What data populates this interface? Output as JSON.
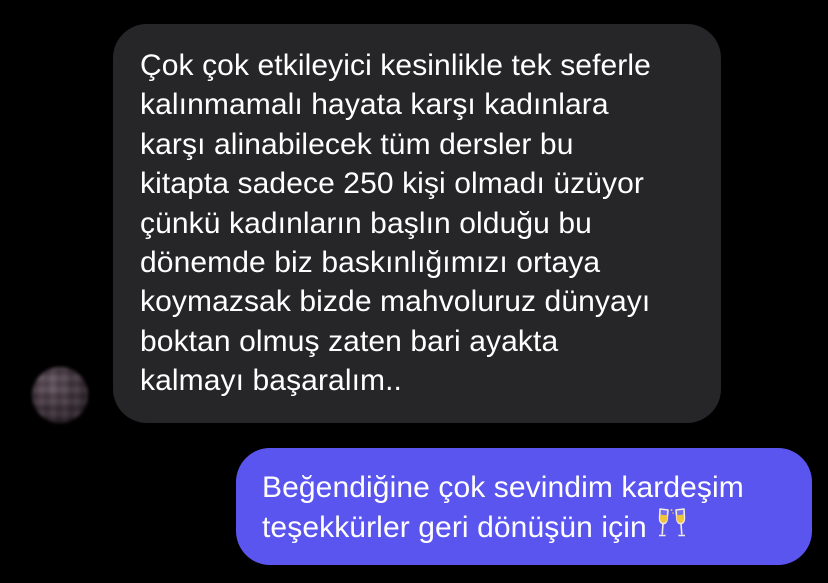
{
  "conversation": {
    "incoming": {
      "text": "Çok çok etkileyici kesinlikle tek seferle\nkalınmamalı hayata karşı kadınlara\nkarşı alinabilecek tüm dersler bu\nkitapta sadece 250 kişi olmadı üzüyor\nçünkü kadınların başlın olduğu bu\ndönemde biz baskınlığımızı ortaya\nkoymazsak bizde mahvoluruz dünyayı\nboktan olmuş zaten bari ayakta\nkalmayı başaralım.."
    },
    "outgoing": {
      "text": "Beğendiğine çok sevindim kardeşim\nteşekkürler geri dönüşün için",
      "emoji_name": "clinking-glasses"
    }
  },
  "colors": {
    "background": "#000000",
    "incoming_bubble": "#262628",
    "outgoing_bubble": "#5b55f0",
    "text": "#ffffff"
  }
}
